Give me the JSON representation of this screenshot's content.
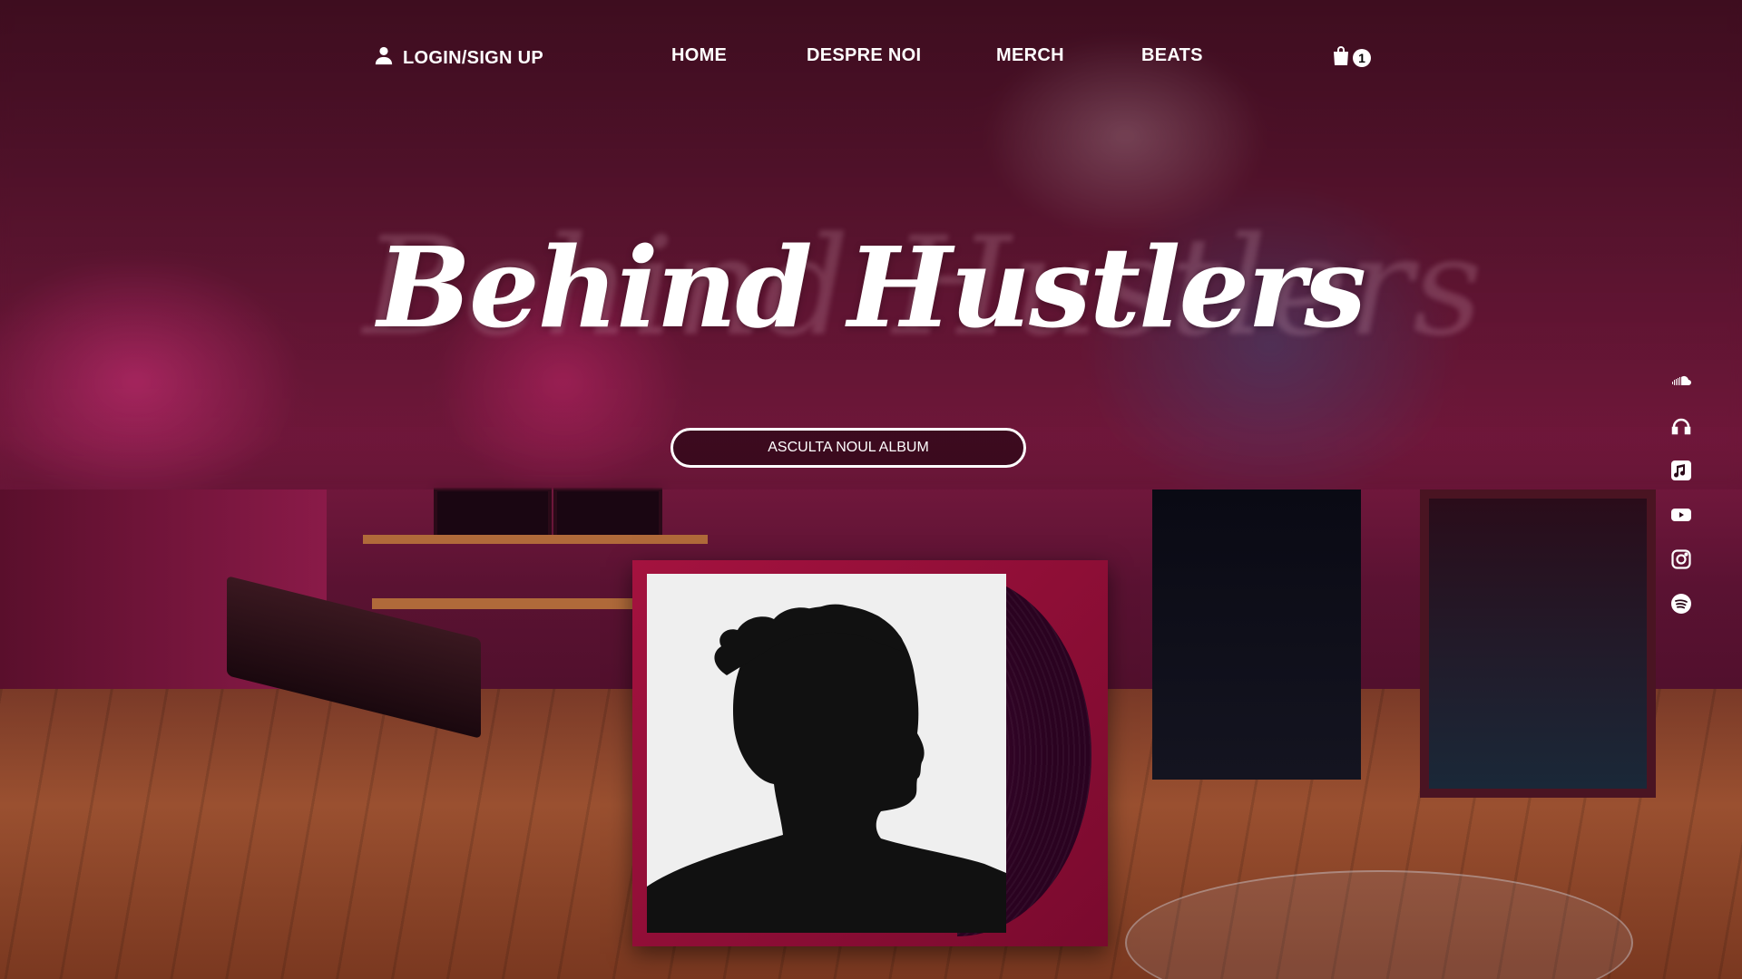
{
  "nav": {
    "login_label": "LOGIN/SIGN UP",
    "items": [
      {
        "label": "HOME"
      },
      {
        "label": "DESPRE NOI"
      },
      {
        "label": "MERCH"
      },
      {
        "label": "BEATS"
      }
    ],
    "cart_count": "1"
  },
  "hero": {
    "title": "Behind Hustlers",
    "cta_label": "ASCULTA NOUL ALBUM"
  },
  "social": {
    "icons": [
      "soundcloud-icon",
      "headphones-icon",
      "apple-music-icon",
      "youtube-icon",
      "instagram-icon",
      "spotify-icon"
    ]
  },
  "colors": {
    "album_frame": "#a4123f",
    "accent": "#ffffff"
  }
}
